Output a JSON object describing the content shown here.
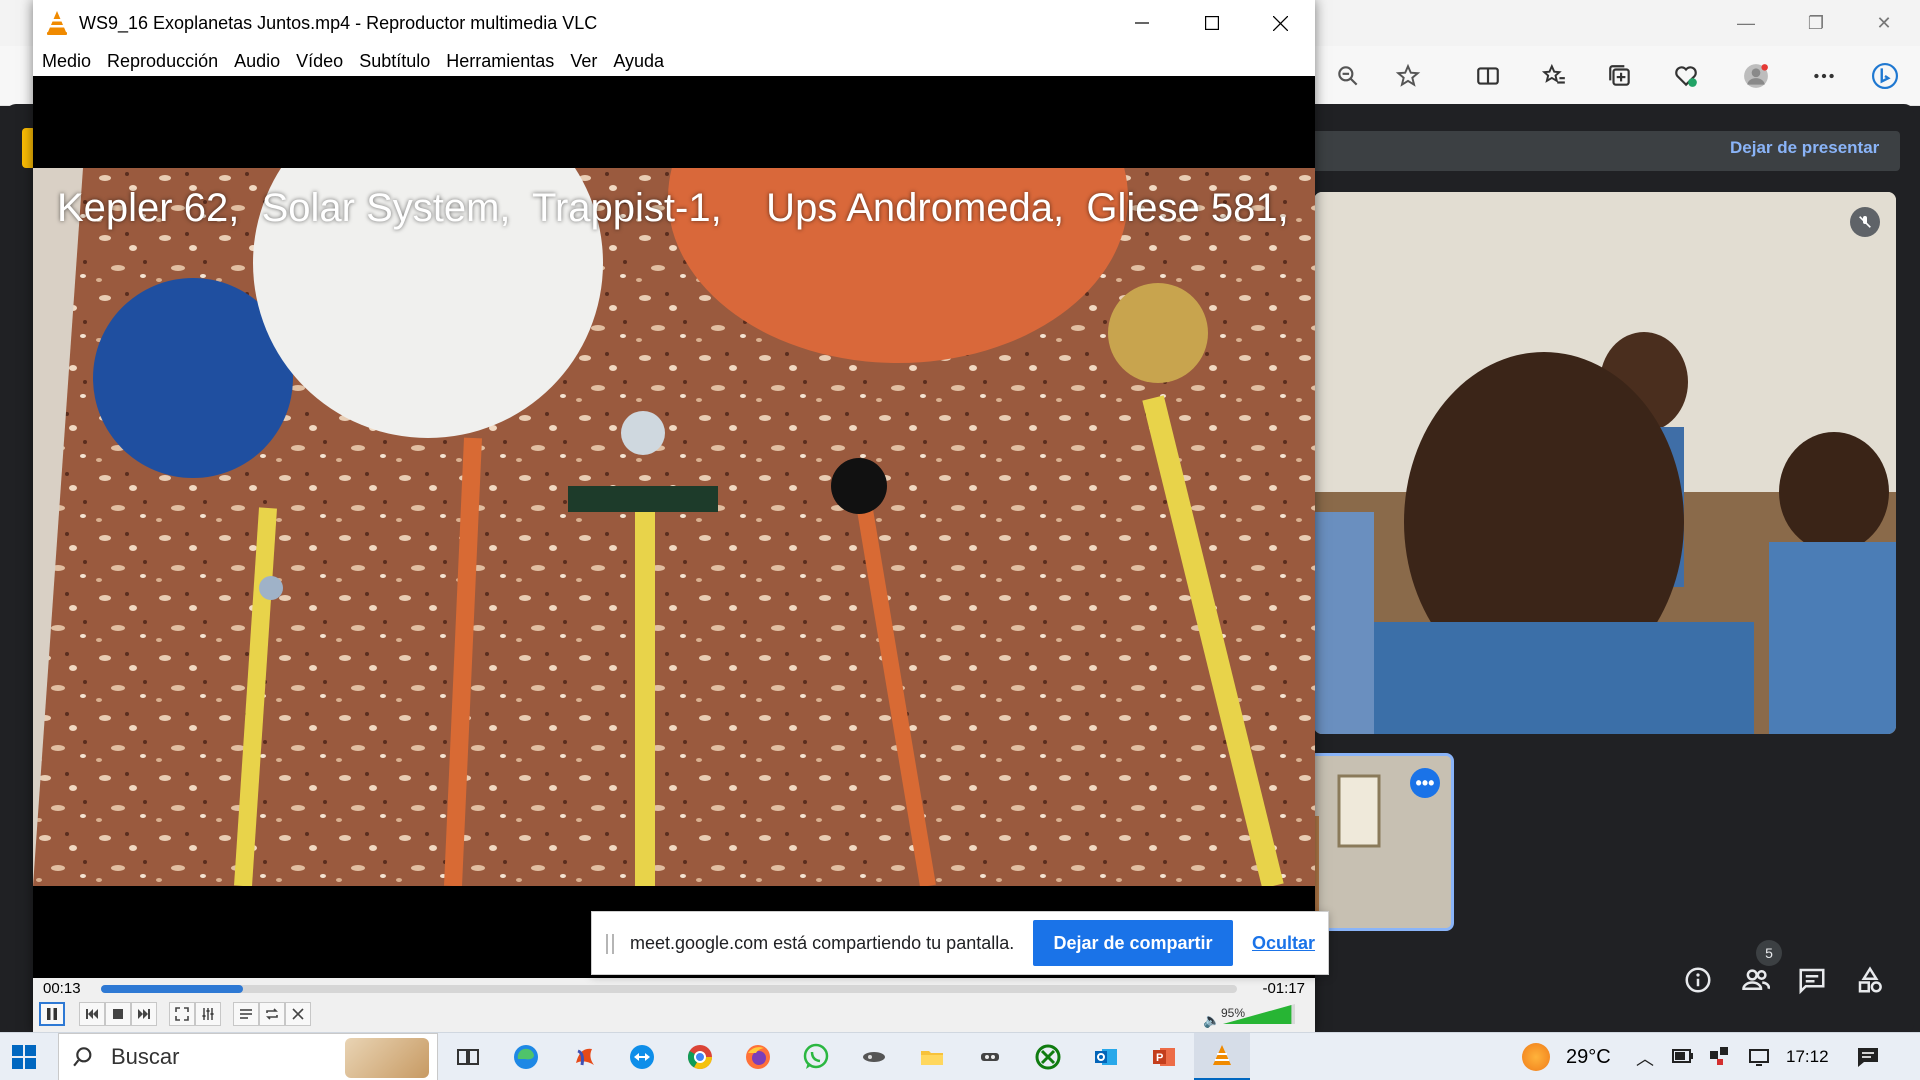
{
  "vlc": {
    "title": "WS9_16 Exoplanetas Juntos.mp4 - Reproductor multimedia VLC",
    "menu": [
      "Medio",
      "Reproducción",
      "Audio",
      "Vídeo",
      "Subtítulo",
      "Herramientas",
      "Ver",
      "Ayuda"
    ],
    "caption": "Kepler 62,  Solar System,  Trappist-1,    Ups Andromeda,  Gliese 581,",
    "time_current": "00:13",
    "time_remaining": "-01:17",
    "playback_progress": 0.125,
    "volume_percent": "95%",
    "volume_level": 0.95,
    "icons": {
      "app": "vlc-cone-icon",
      "minimize": "minimize-icon",
      "maximize": "maximize-icon",
      "close": "close-icon",
      "controls": [
        "pause-icon",
        "previous-icon",
        "stop-icon",
        "next-icon",
        "fullscreen-icon",
        "extended-settings-icon",
        "playlist-icon",
        "loop-icon",
        "shuffle-icon",
        "volume-icon"
      ]
    }
  },
  "share_bar": {
    "message": "meet.google.com está compartiendo tu pantalla.",
    "stop_label": "Dejar de compartir",
    "hide_label": "Ocultar"
  },
  "meet": {
    "stop_presenting": "Dejar de presentar",
    "people_count": "5",
    "accent": "#8ab4f8",
    "icons": [
      "mic-off-icon",
      "more-options-icon",
      "info-icon",
      "people-icon",
      "chat-icon",
      "activities-icon"
    ]
  },
  "browser": {
    "toolbar_icons": [
      "zoom-icon",
      "favorite-star-icon",
      "split-screen-icon",
      "favorites-icon",
      "collections-icon",
      "browser-health-icon",
      "profile-avatar-icon",
      "more-menu-icon",
      "bing-icon"
    ]
  },
  "taskbar": {
    "search_label": "Buscar",
    "temperature": "29°C",
    "time": "17:12",
    "apps": [
      "task-view-icon",
      "edge-icon",
      "office-icon",
      "teamviewer-icon",
      "chrome-icon",
      "firefox-icon",
      "whatsapp-icon",
      "media-icon",
      "file-explorer-icon",
      "tool-icon",
      "xbox-icon",
      "outlook-icon",
      "powerpoint-icon",
      "vlc-icon"
    ],
    "tray": [
      "chevron-up-icon",
      "battery-icon",
      "network-icon",
      "cast-icon",
      "notifications-icon"
    ]
  },
  "colors": {
    "vlc_progress": "#2e79d4",
    "meet_blue": "#1a73e8",
    "vlc_cone": "#f08a00"
  }
}
